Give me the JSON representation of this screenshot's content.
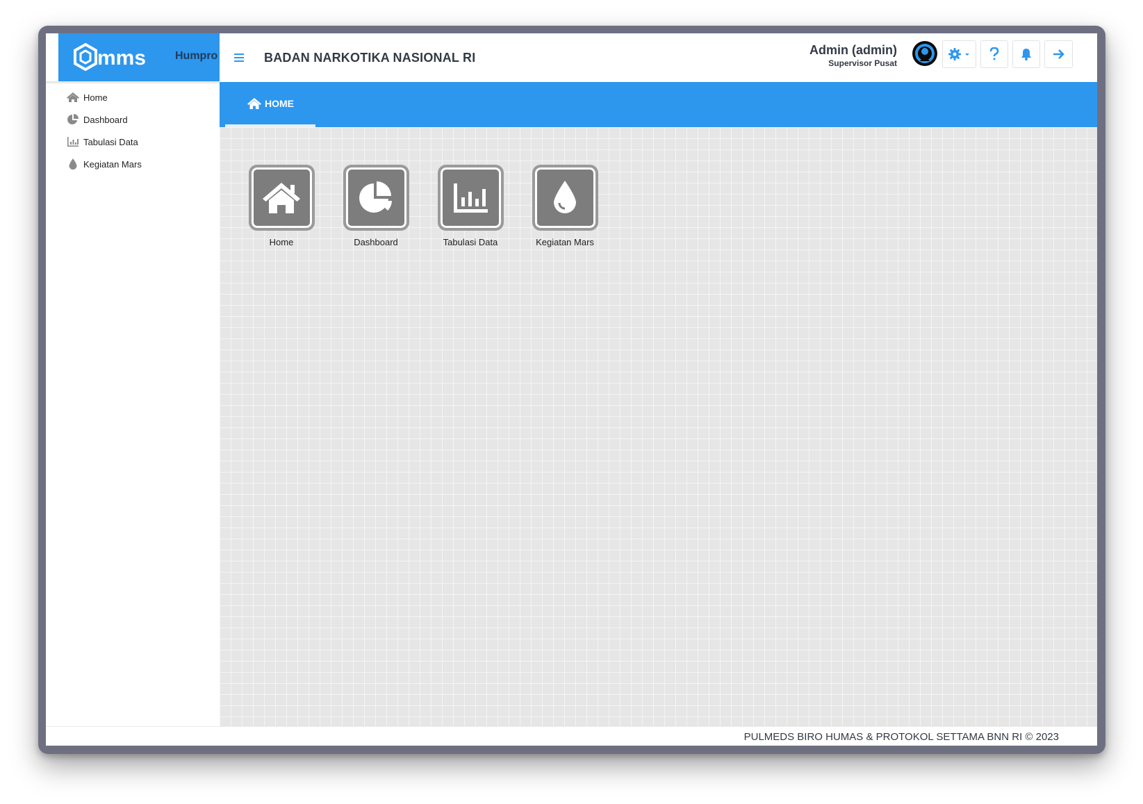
{
  "brand": {
    "logo_text": "mms",
    "app_name": "Humpro"
  },
  "header": {
    "title": "BADAN NARKOTIKA NASIONAL RI",
    "user_name": "Admin (admin)",
    "user_role": "Supervisor Pusat",
    "icons": [
      "menu-icon",
      "avatar-icon",
      "gear-icon",
      "help-icon",
      "bell-icon",
      "logout-icon"
    ]
  },
  "sidebar": {
    "items": [
      {
        "label": "Home",
        "icon": "home-icon"
      },
      {
        "label": "Dashboard",
        "icon": "pie-chart-icon"
      },
      {
        "label": "Tabulasi Data",
        "icon": "bar-chart-icon"
      },
      {
        "label": "Kegiatan Mars",
        "icon": "drop-icon"
      }
    ]
  },
  "tabs": [
    {
      "label": "HOME",
      "icon": "home-icon",
      "active": true
    }
  ],
  "tiles": [
    {
      "label": "Home",
      "icon": "home-icon"
    },
    {
      "label": "Dashboard",
      "icon": "pie-chart-icon"
    },
    {
      "label": "Tabulasi Data",
      "icon": "bar-chart-icon"
    },
    {
      "label": "Kegiatan Mars",
      "icon": "drop-icon"
    }
  ],
  "footer": {
    "text": "PULMEDS BIRO HUMAS & PROTOKOL SETTAMA BNN RI © 2023"
  },
  "colors": {
    "primary": "#2d97ee",
    "tile": "#7d7d7d",
    "content_bg": "#e6e6e6"
  }
}
